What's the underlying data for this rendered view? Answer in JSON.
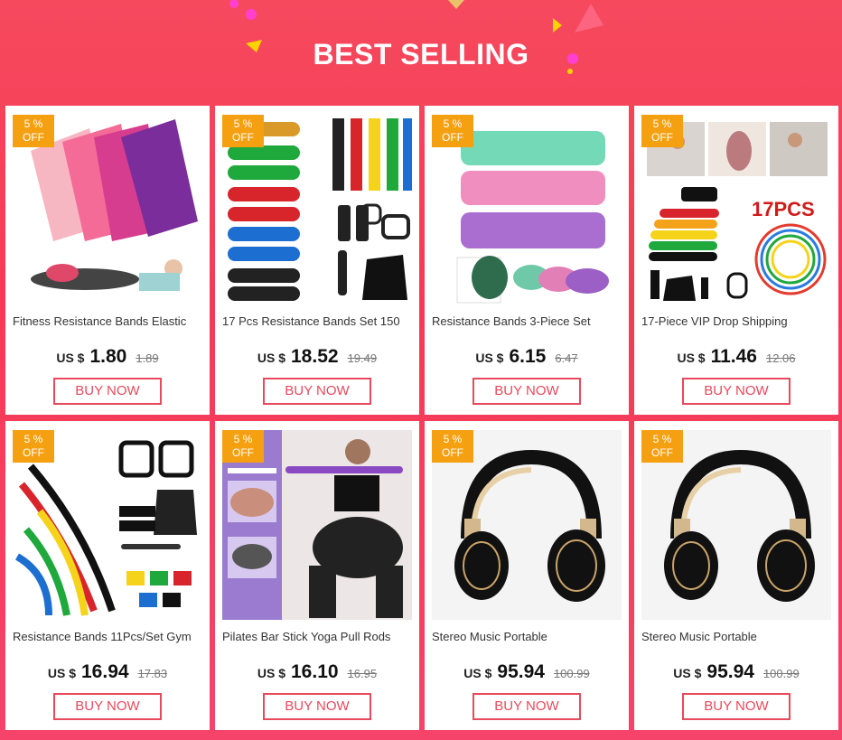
{
  "header": {
    "title": "BEST SELLING"
  },
  "colors": {
    "accent": "#e8495c",
    "badge": "#f5a011",
    "background": "#f6495e"
  },
  "products": [
    {
      "name": "Fitness Resistance Bands Elastic",
      "discount_pct": "5 %",
      "discount_label": "OFF",
      "currency": "US $",
      "price": "1.80",
      "old_price": "1.89",
      "buy_label": "BUY NOW",
      "image": "pink-purple-bands-with-woman"
    },
    {
      "name": "17 Pcs Resistance Bands Set 150",
      "discount_pct": "5 %",
      "discount_label": "OFF",
      "currency": "US $",
      "price": "18.52",
      "old_price": "19.49",
      "buy_label": "BUY NOW",
      "image": "tube-bands-set"
    },
    {
      "name": "Resistance Bands 3-Piece Set",
      "discount_pct": "5 %",
      "discount_label": "OFF",
      "currency": "US $",
      "price": "6.15",
      "old_price": "6.47",
      "buy_label": "BUY NOW",
      "image": "fabric-hip-bands"
    },
    {
      "name": "17-Piece VIP Drop Shipping",
      "discount_pct": "5 %",
      "discount_label": "OFF",
      "currency": "US $",
      "price": "11.46",
      "old_price": "12.06",
      "buy_label": "BUY NOW",
      "image": "17pcs-set",
      "image_text": "17PCS"
    },
    {
      "name": "Resistance Bands 11Pcs/Set Gym",
      "discount_pct": "5 %",
      "discount_label": "OFF",
      "currency": "US $",
      "price": "16.94",
      "old_price": "17.83",
      "buy_label": "BUY NOW",
      "image": "11pcs-tube-set"
    },
    {
      "name": "Pilates Bar Stick Yoga Pull Rods",
      "discount_pct": "5 %",
      "discount_label": "OFF",
      "currency": "US $",
      "price": "16.10",
      "old_price": "16.95",
      "buy_label": "BUY NOW",
      "image": "pilates-bar-woman"
    },
    {
      "name": "Stereo Music Portable",
      "discount_pct": "5 %",
      "discount_label": "OFF",
      "currency": "US $",
      "price": "95.94",
      "old_price": "100.99",
      "buy_label": "BUY NOW",
      "image": "black-gold-headphones"
    },
    {
      "name": "Stereo Music Portable",
      "discount_pct": "5 %",
      "discount_label": "OFF",
      "currency": "US $",
      "price": "95.94",
      "old_price": "100.99",
      "buy_label": "BUY NOW",
      "image": "black-gold-headphones"
    }
  ]
}
